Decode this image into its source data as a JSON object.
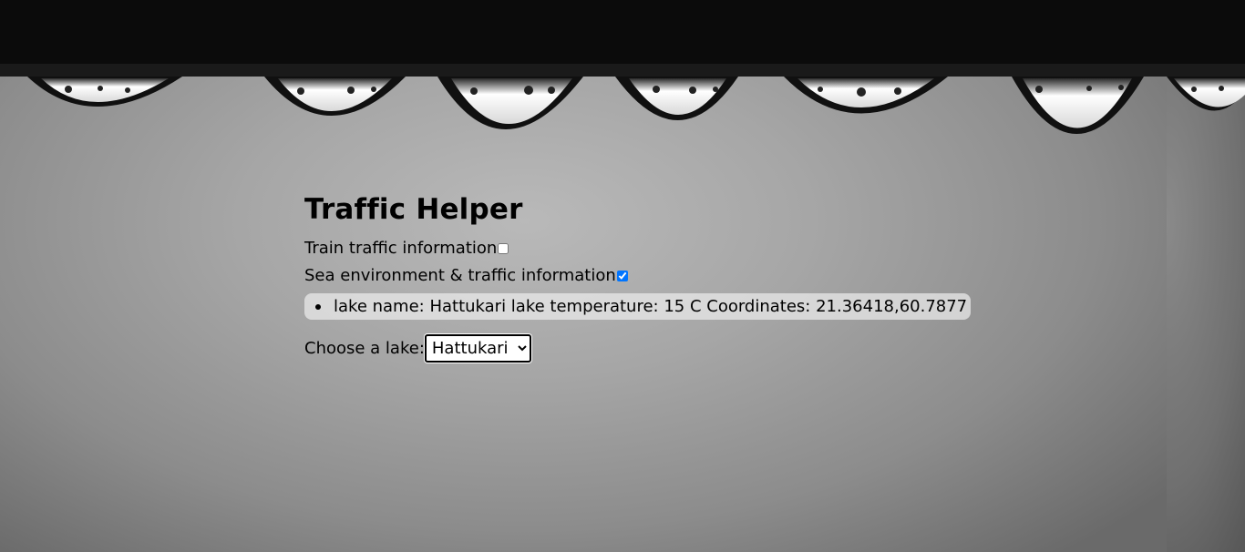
{
  "page": {
    "title": "Traffic Helper"
  },
  "options": {
    "train_label": "Train traffic information",
    "train_checked": false,
    "sea_label": "Sea environment & traffic information",
    "sea_checked": true
  },
  "lakes": {
    "items": [
      "lake name: Hattukari lake temperature: 15 C Coordinates: 21.36418,60.7877"
    ],
    "chooser_label": "Choose a lake:",
    "selected": "Hattukari"
  },
  "colors": {
    "background": "#a6a6a6",
    "text": "#000000",
    "checkbox_accent": "#0075ff"
  }
}
